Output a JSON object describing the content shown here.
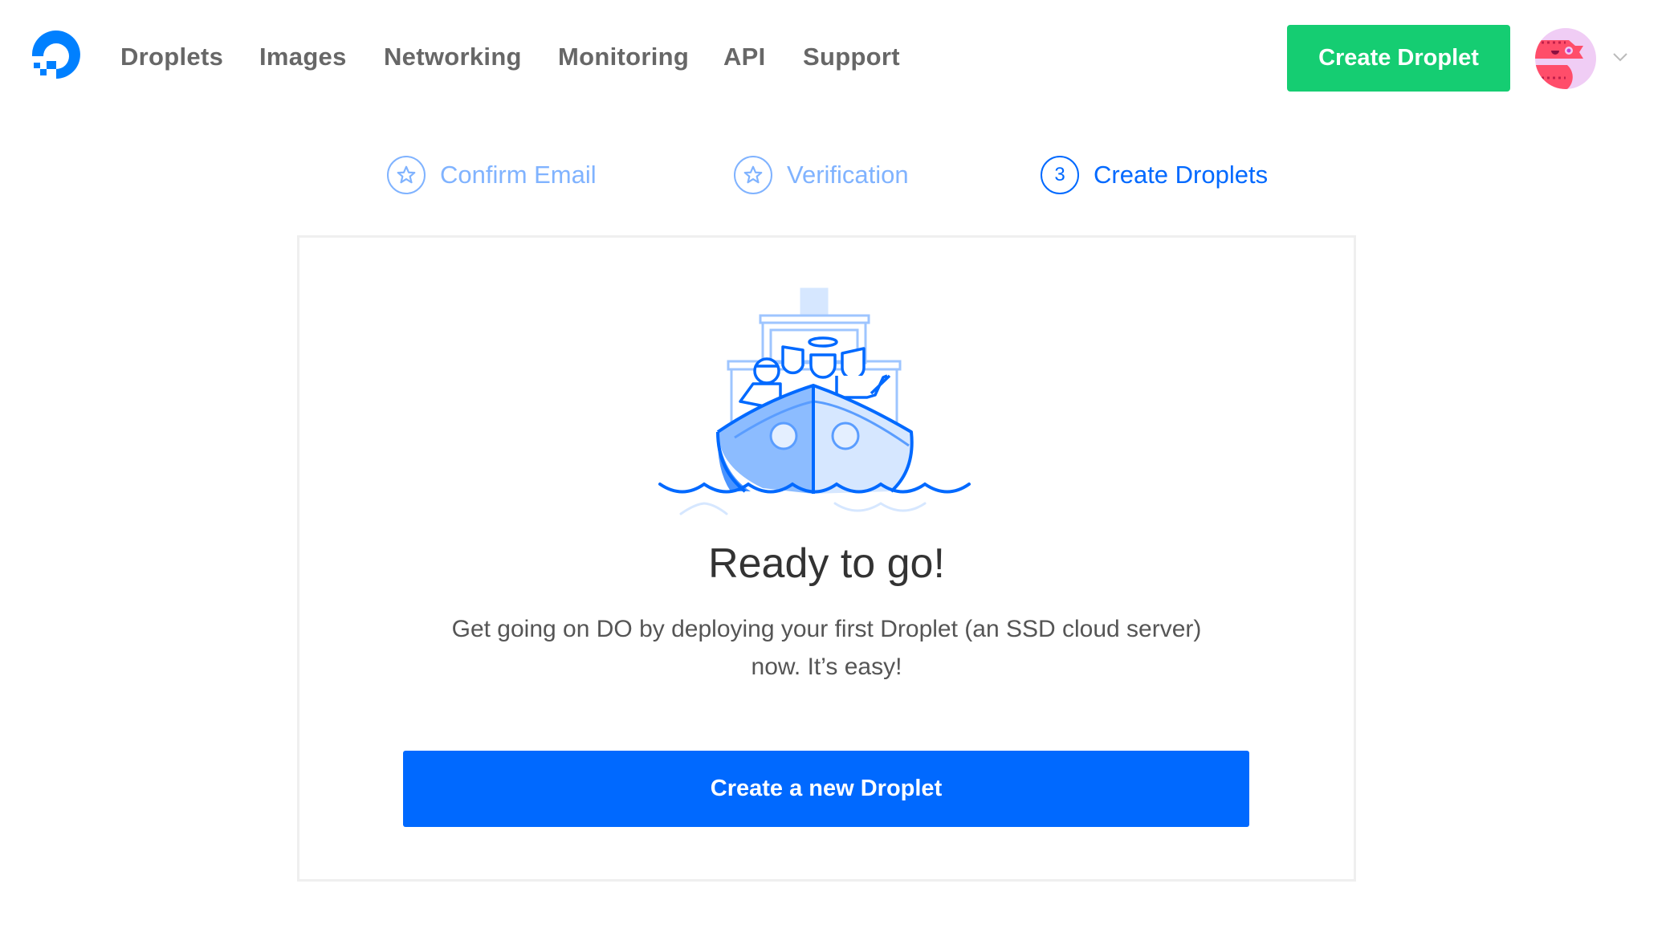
{
  "nav": {
    "items": [
      {
        "label": "Droplets"
      },
      {
        "label": "Images"
      },
      {
        "label": "Networking"
      },
      {
        "label": "Monitoring"
      },
      {
        "label": "API"
      },
      {
        "label": "Support"
      }
    ],
    "create_button": "Create Droplet"
  },
  "steps": [
    {
      "label": "Confirm Email",
      "icon": "star-icon",
      "state": "complete"
    },
    {
      "label": "Verification",
      "icon": "star-icon",
      "state": "complete"
    },
    {
      "label": "Create Droplets",
      "number": "3",
      "state": "current"
    }
  ],
  "card": {
    "heading": "Ready to go!",
    "line1": "Get going on DO by deploying your first Droplet (an SSD cloud server)",
    "line2": "now. It’s easy!",
    "button": "Create a new Droplet"
  },
  "colors": {
    "brand_blue": "#0069ff",
    "green": "#15cd72",
    "step_done": "#80b3ff"
  }
}
